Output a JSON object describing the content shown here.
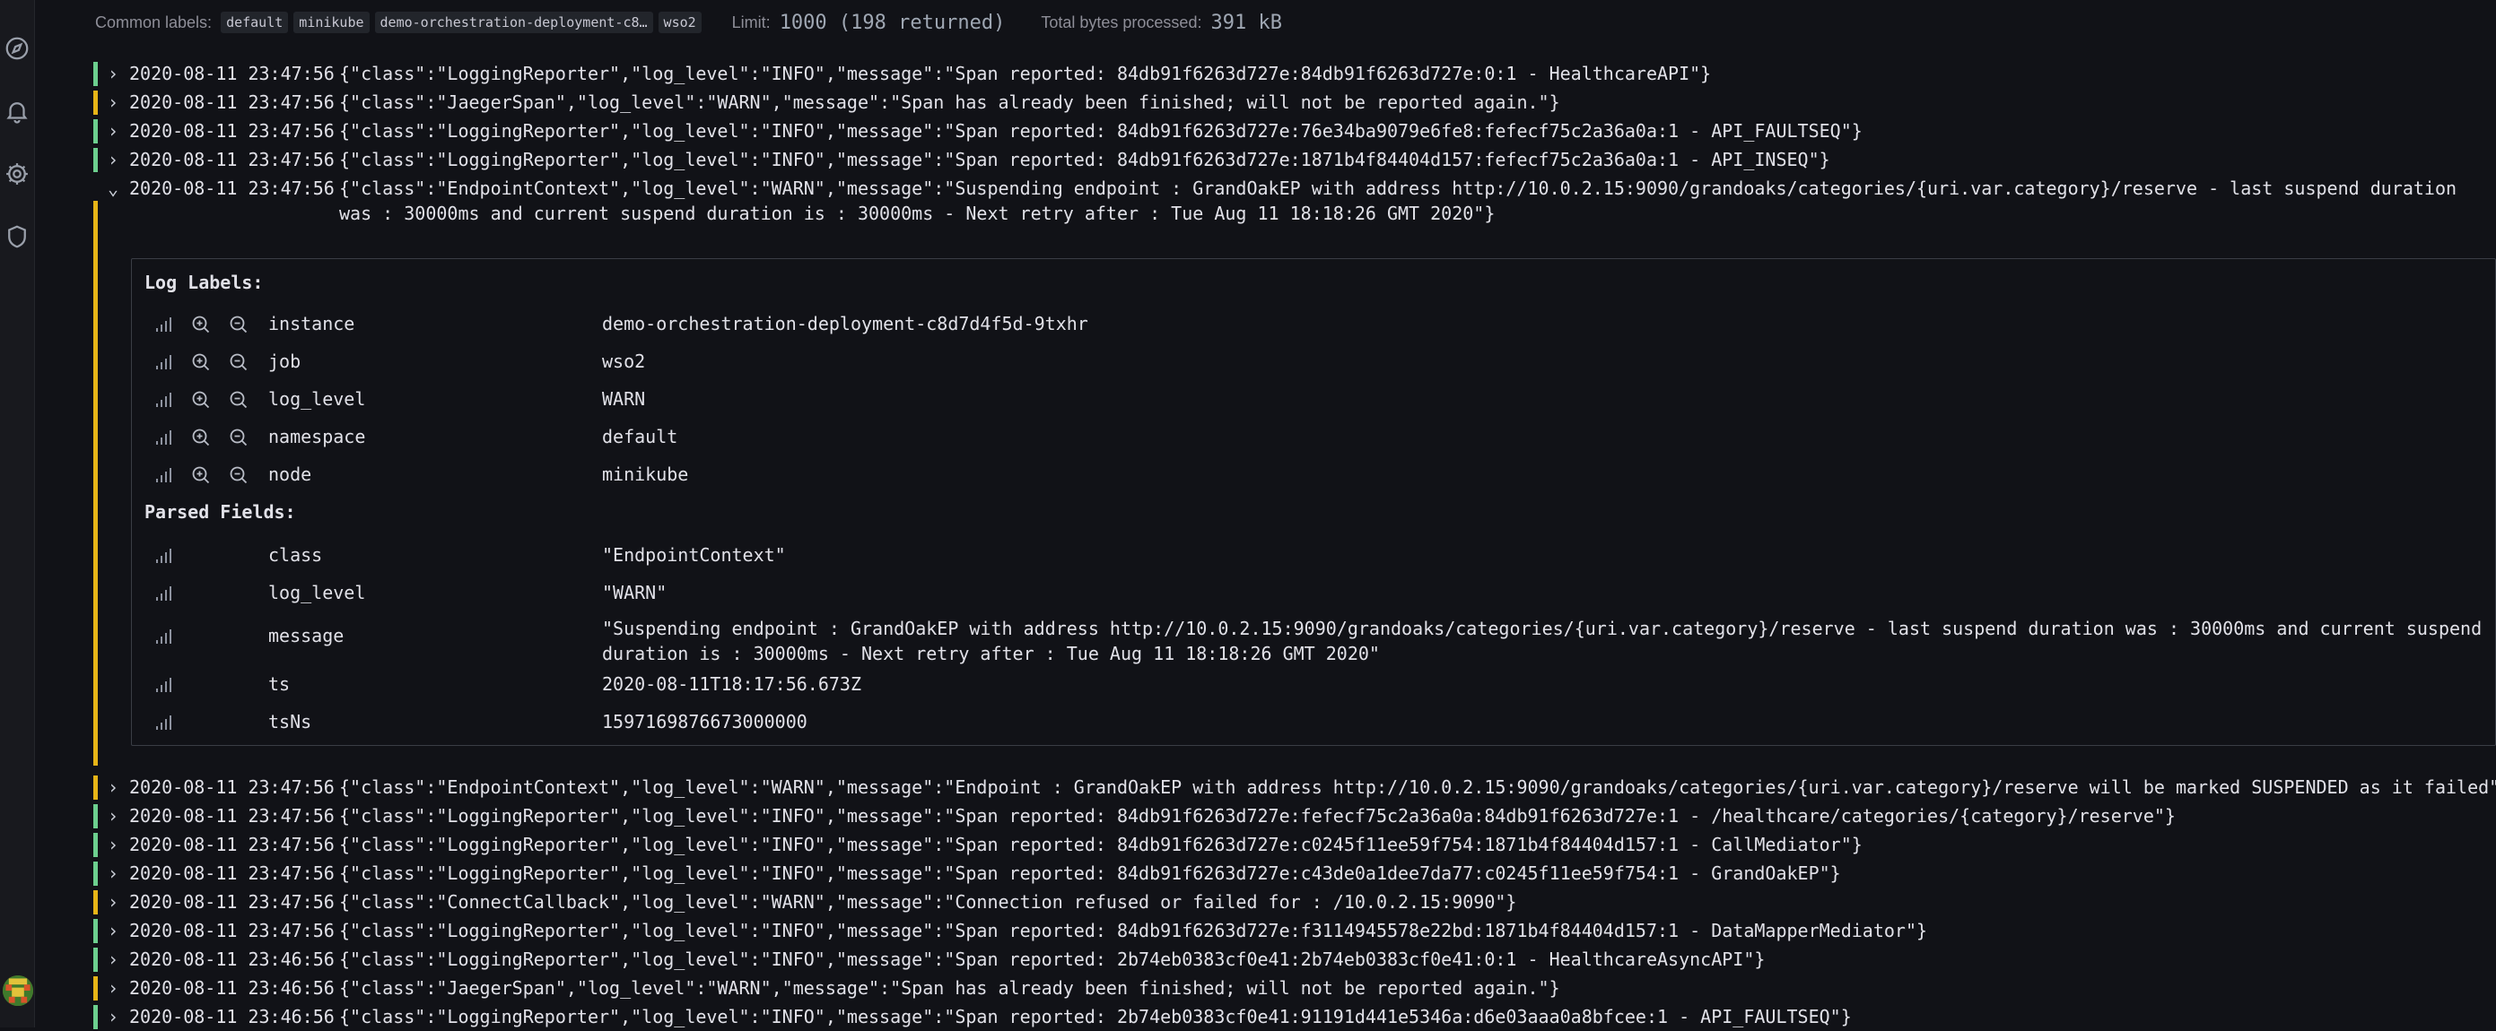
{
  "meta": {
    "common_labels_key": "Common labels:",
    "common_labels": [
      "default",
      "minikube",
      "demo-orchestration-deployment-c8…",
      "wso2"
    ],
    "limit_key": "Limit:",
    "limit_value": "1000 (198 returned)",
    "bytes_key": "Total bytes processed:",
    "bytes_value": "391 kB"
  },
  "colors": {
    "info": "#6ccf8e",
    "warn": "#e7b417"
  },
  "nav": {
    "icons": [
      "compass-icon",
      "bell-icon",
      "gear-icon",
      "shield-icon",
      "avatar"
    ]
  },
  "logs_before": [
    {
      "level": "info",
      "expand": "›",
      "ts": "2020-08-11 23:47:56",
      "msg": "{\"class\":\"LoggingReporter\",\"log_level\":\"INFO\",\"message\":\"Span reported: 84db91f6263d727e:84db91f6263d727e:0:1 - HealthcareAPI\"}"
    },
    {
      "level": "warn",
      "expand": "›",
      "ts": "2020-08-11 23:47:56",
      "msg": "{\"class\":\"JaegerSpan\",\"log_level\":\"WARN\",\"message\":\"Span has already been finished; will not be reported again.\"}"
    },
    {
      "level": "info",
      "expand": "›",
      "ts": "2020-08-11 23:47:56",
      "msg": "{\"class\":\"LoggingReporter\",\"log_level\":\"INFO\",\"message\":\"Span reported: 84db91f6263d727e:76e34ba9079e6fe8:fefecf75c2a36a0a:1 - API_FAULTSEQ\"}"
    },
    {
      "level": "info",
      "expand": "›",
      "ts": "2020-08-11 23:47:56",
      "msg": "{\"class\":\"LoggingReporter\",\"log_level\":\"INFO\",\"message\":\"Span reported: 84db91f6263d727e:1871b4f84404d157:fefecf75c2a36a0a:1 - API_INSEQ\"}"
    }
  ],
  "expanded": {
    "level": "warn",
    "expand": "⌄",
    "ts": "2020-08-11 23:47:56",
    "msg": "{\"class\":\"EndpointContext\",\"log_level\":\"WARN\",\"message\":\"Suspending endpoint : GrandOakEP with address http://10.0.2.15:9090/grandoaks/categories/{uri.var.category}/reserve - last suspend duration was : 30000ms and current suspend duration is : 30000ms - Next retry after : Tue Aug 11 18:18:26 GMT 2020\"}",
    "log_labels_title": "Log Labels:",
    "labels": [
      {
        "key": "instance",
        "value": "demo-orchestration-deployment-c8d7d4f5d-9txhr"
      },
      {
        "key": "job",
        "value": "wso2"
      },
      {
        "key": "log_level",
        "value": "WARN"
      },
      {
        "key": "namespace",
        "value": "default"
      },
      {
        "key": "node",
        "value": "minikube"
      }
    ],
    "parsed_fields_title": "Parsed Fields:",
    "fields": [
      {
        "key": "class",
        "value": "\"EndpointContext\""
      },
      {
        "key": "log_level",
        "value": "\"WARN\""
      },
      {
        "key": "message",
        "value": "\"Suspending endpoint : GrandOakEP with address http://10.0.2.15:9090/grandoaks/categories/{uri.var.category}/reserve - last suspend duration was : 30000ms and current suspend duration is : 30000ms - Next retry after : Tue Aug 11 18:18:26 GMT 2020\""
      },
      {
        "key": "ts",
        "value": "2020-08-11T18:17:56.673Z"
      },
      {
        "key": "tsNs",
        "value": "1597169876673000000"
      }
    ]
  },
  "logs_after": [
    {
      "level": "warn",
      "expand": "›",
      "ts": "2020-08-11 23:47:56",
      "msg": "{\"class\":\"EndpointContext\",\"log_level\":\"WARN\",\"message\":\"Endpoint : GrandOakEP with address http://10.0.2.15:9090/grandoaks/categories/{uri.var.category}/reserve will be marked SUSPENDED as it failed\"}"
    },
    {
      "level": "info",
      "expand": "›",
      "ts": "2020-08-11 23:47:56",
      "msg": "{\"class\":\"LoggingReporter\",\"log_level\":\"INFO\",\"message\":\"Span reported: 84db91f6263d727e:fefecf75c2a36a0a:84db91f6263d727e:1 - /healthcare/categories/{category}/reserve\"}"
    },
    {
      "level": "info",
      "expand": "›",
      "ts": "2020-08-11 23:47:56",
      "msg": "{\"class\":\"LoggingReporter\",\"log_level\":\"INFO\",\"message\":\"Span reported: 84db91f6263d727e:c0245f11ee59f754:1871b4f84404d157:1 - CallMediator\"}"
    },
    {
      "level": "info",
      "expand": "›",
      "ts": "2020-08-11 23:47:56",
      "msg": "{\"class\":\"LoggingReporter\",\"log_level\":\"INFO\",\"message\":\"Span reported: 84db91f6263d727e:c43de0a1dee7da77:c0245f11ee59f754:1 - GrandOakEP\"}"
    },
    {
      "level": "warn",
      "expand": "›",
      "ts": "2020-08-11 23:47:56",
      "msg": "{\"class\":\"ConnectCallback\",\"log_level\":\"WARN\",\"message\":\"Connection refused or failed for : /10.0.2.15:9090\"}"
    },
    {
      "level": "info",
      "expand": "›",
      "ts": "2020-08-11 23:47:56",
      "msg": "{\"class\":\"LoggingReporter\",\"log_level\":\"INFO\",\"message\":\"Span reported: 84db91f6263d727e:f3114945578e22bd:1871b4f84404d157:1 - DataMapperMediator\"}"
    },
    {
      "level": "info",
      "expand": "›",
      "ts": "2020-08-11 23:46:56",
      "msg": "{\"class\":\"LoggingReporter\",\"log_level\":\"INFO\",\"message\":\"Span reported: 2b74eb0383cf0e41:2b74eb0383cf0e41:0:1 - HealthcareAsyncAPI\"}"
    },
    {
      "level": "warn",
      "expand": "›",
      "ts": "2020-08-11 23:46:56",
      "msg": "{\"class\":\"JaegerSpan\",\"log_level\":\"WARN\",\"message\":\"Span has already been finished; will not be reported again.\"}"
    },
    {
      "level": "info",
      "expand": "›",
      "ts": "2020-08-11 23:46:56",
      "msg": "{\"class\":\"LoggingReporter\",\"log_level\":\"INFO\",\"message\":\"Span reported: 2b74eb0383cf0e41:91191d441e5346a:d6e03aaa0a8bfcee:1 - API_FAULTSEQ\"}"
    }
  ]
}
